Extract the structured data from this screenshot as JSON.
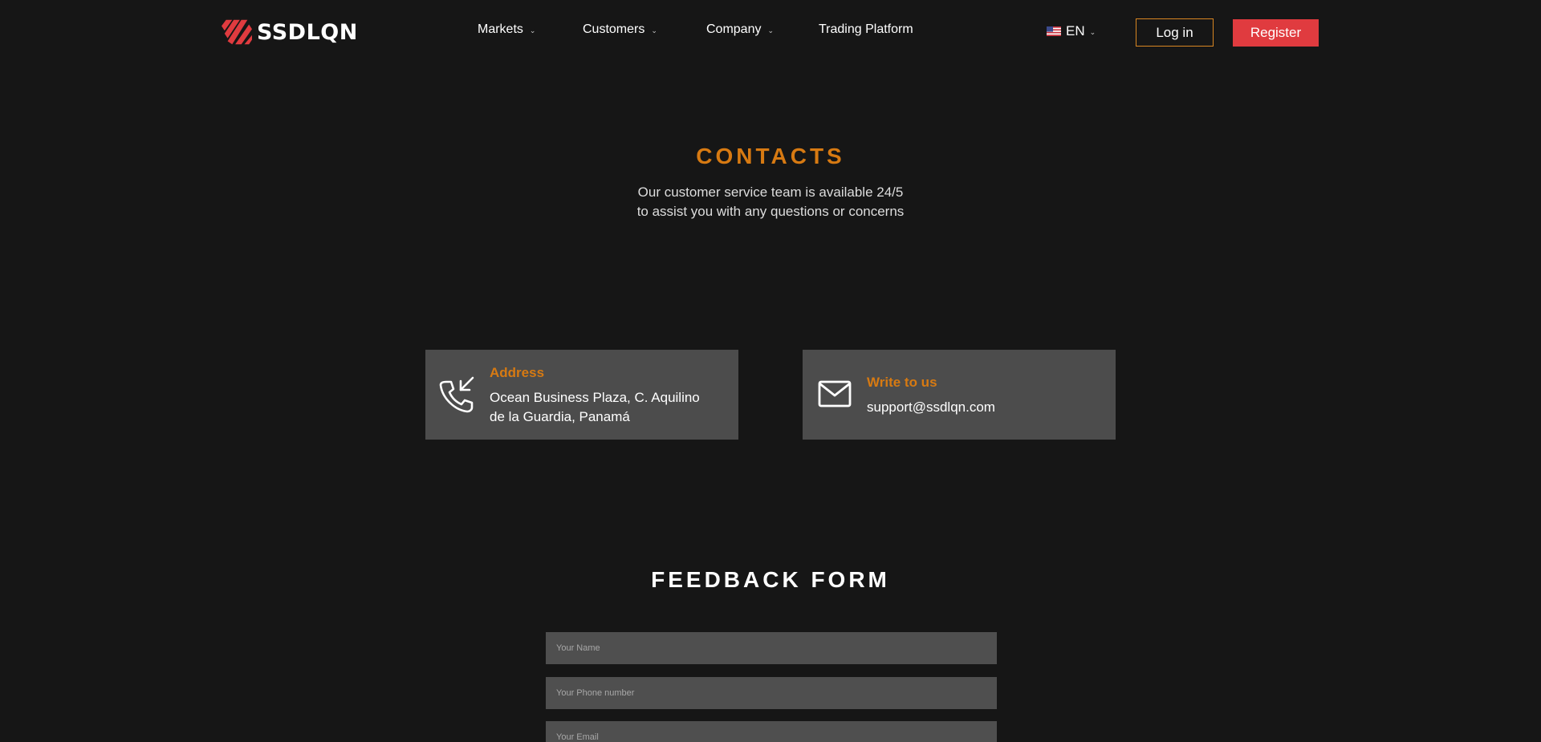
{
  "header": {
    "logo_text": "SSDLQN",
    "nav": [
      {
        "label": "Markets",
        "has_dropdown": true
      },
      {
        "label": "Customers",
        "has_dropdown": true
      },
      {
        "label": "Company",
        "has_dropdown": true
      },
      {
        "label": "Trading Platform",
        "has_dropdown": false
      }
    ],
    "language": "EN",
    "login_label": "Log in",
    "register_label": "Register"
  },
  "contacts": {
    "title": "CONTACTS",
    "subtitle_line1": "Our customer service team is available 24/5",
    "subtitle_line2": "to assist you with any questions or concerns",
    "address": {
      "label": "Address",
      "line1": "Ocean Business Plaza, C. Aquilino",
      "line2": "de la Guardia, Panamá",
      "icon": "phone-incoming-icon"
    },
    "write": {
      "label": "Write to us",
      "email": "support@ssdlqn.com",
      "icon": "mail-icon"
    }
  },
  "feedback": {
    "title": "FEEDBACK FORM",
    "fields": [
      {
        "placeholder": "Your Name",
        "value": ""
      },
      {
        "placeholder": "Your Phone number",
        "value": ""
      },
      {
        "placeholder": "Your Email",
        "value": ""
      }
    ]
  },
  "colors": {
    "background": "#161616",
    "accent_orange": "#d77a12",
    "register_red": "#e03b3f",
    "card_gray": "#4c4c4c",
    "field_gray": "#4f4f4f"
  }
}
